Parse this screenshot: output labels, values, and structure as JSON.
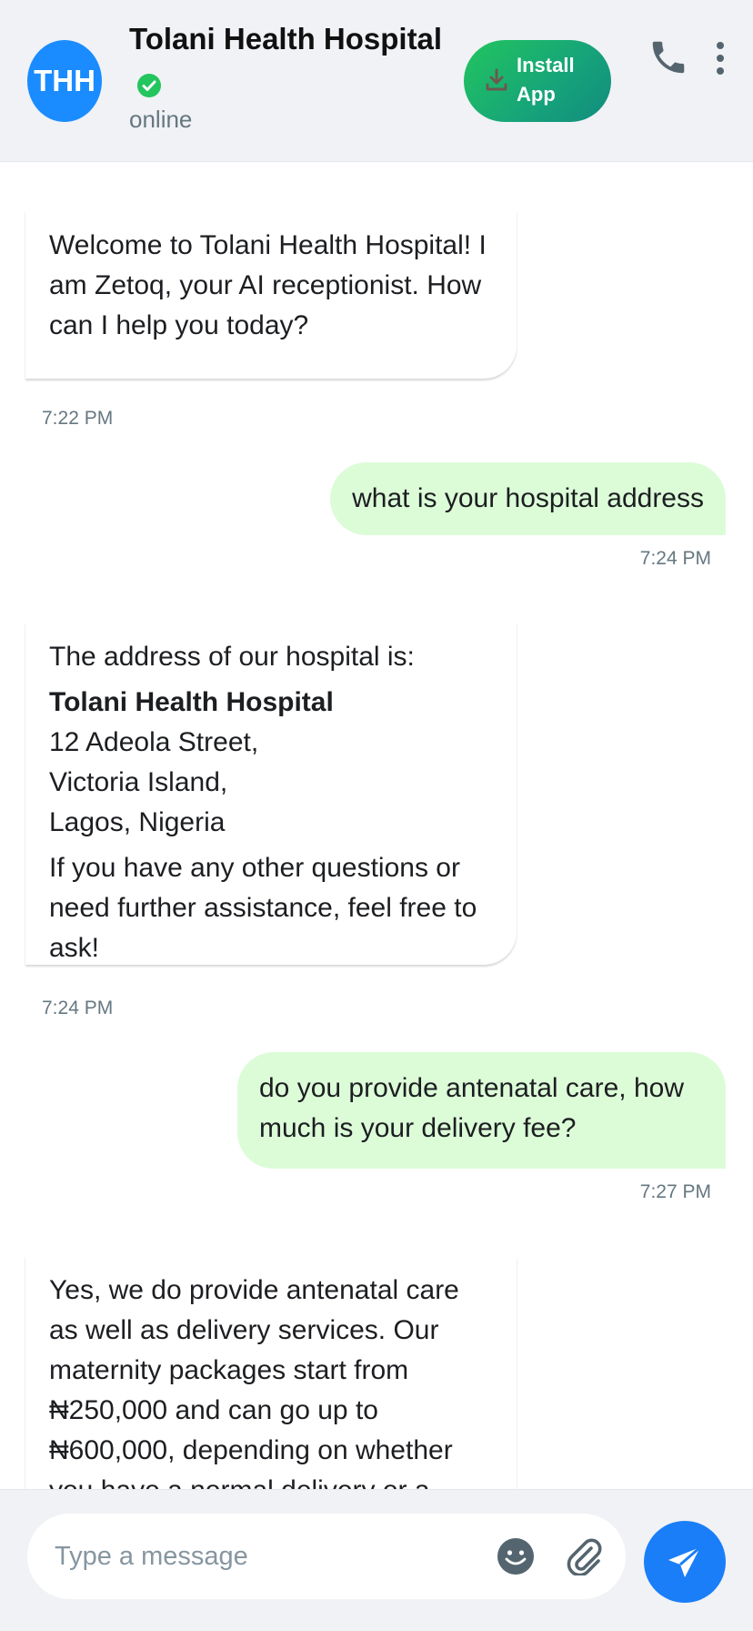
{
  "header": {
    "avatar_initials": "THH",
    "title": "Tolani Health Hospital",
    "status": "online",
    "install_label": "Install App",
    "verified_icon": "check-circle-icon",
    "call_icon": "phone-icon",
    "more_icon": "more-vertical-icon"
  },
  "messages": [
    {
      "from": "bot",
      "text": "Welcome to Tolani Health Hospital! I am Zetoq, your AI receptionist. How can I help you today?",
      "time": "7:22 PM"
    },
    {
      "from": "user",
      "text": "what is your hospital address",
      "time": "7:24 PM"
    },
    {
      "from": "bot",
      "intro": "The address of our hospital is:",
      "address_name": "Tolani Health Hospital",
      "address_lines": [
        "12 Adeola Street,",
        "Victoria Island,",
        "Lagos, Nigeria"
      ],
      "outro": "If you have any other questions or need further assistance, feel free to ask!",
      "time": "7:24 PM"
    },
    {
      "from": "user",
      "text": "do you provide antenatal care, how much is your delivery fee?",
      "time": "7:27 PM"
    },
    {
      "from": "bot",
      "text": "Yes, we do provide antenatal care as well as delivery services. Our maternity packages start from ₦250,000 and can go up to ₦600,000, depending on whether you have a normal delivery or a"
    }
  ],
  "composer": {
    "placeholder": "Type a message",
    "emoji_icon": "emoji-icon",
    "attach_icon": "paperclip-icon",
    "send_icon": "send-icon"
  },
  "colors": {
    "accent": "#1a7ef8",
    "user_bubble": "#dcfcd8",
    "online_green": "#22c55e",
    "header_bg": "#f0f2f5"
  }
}
